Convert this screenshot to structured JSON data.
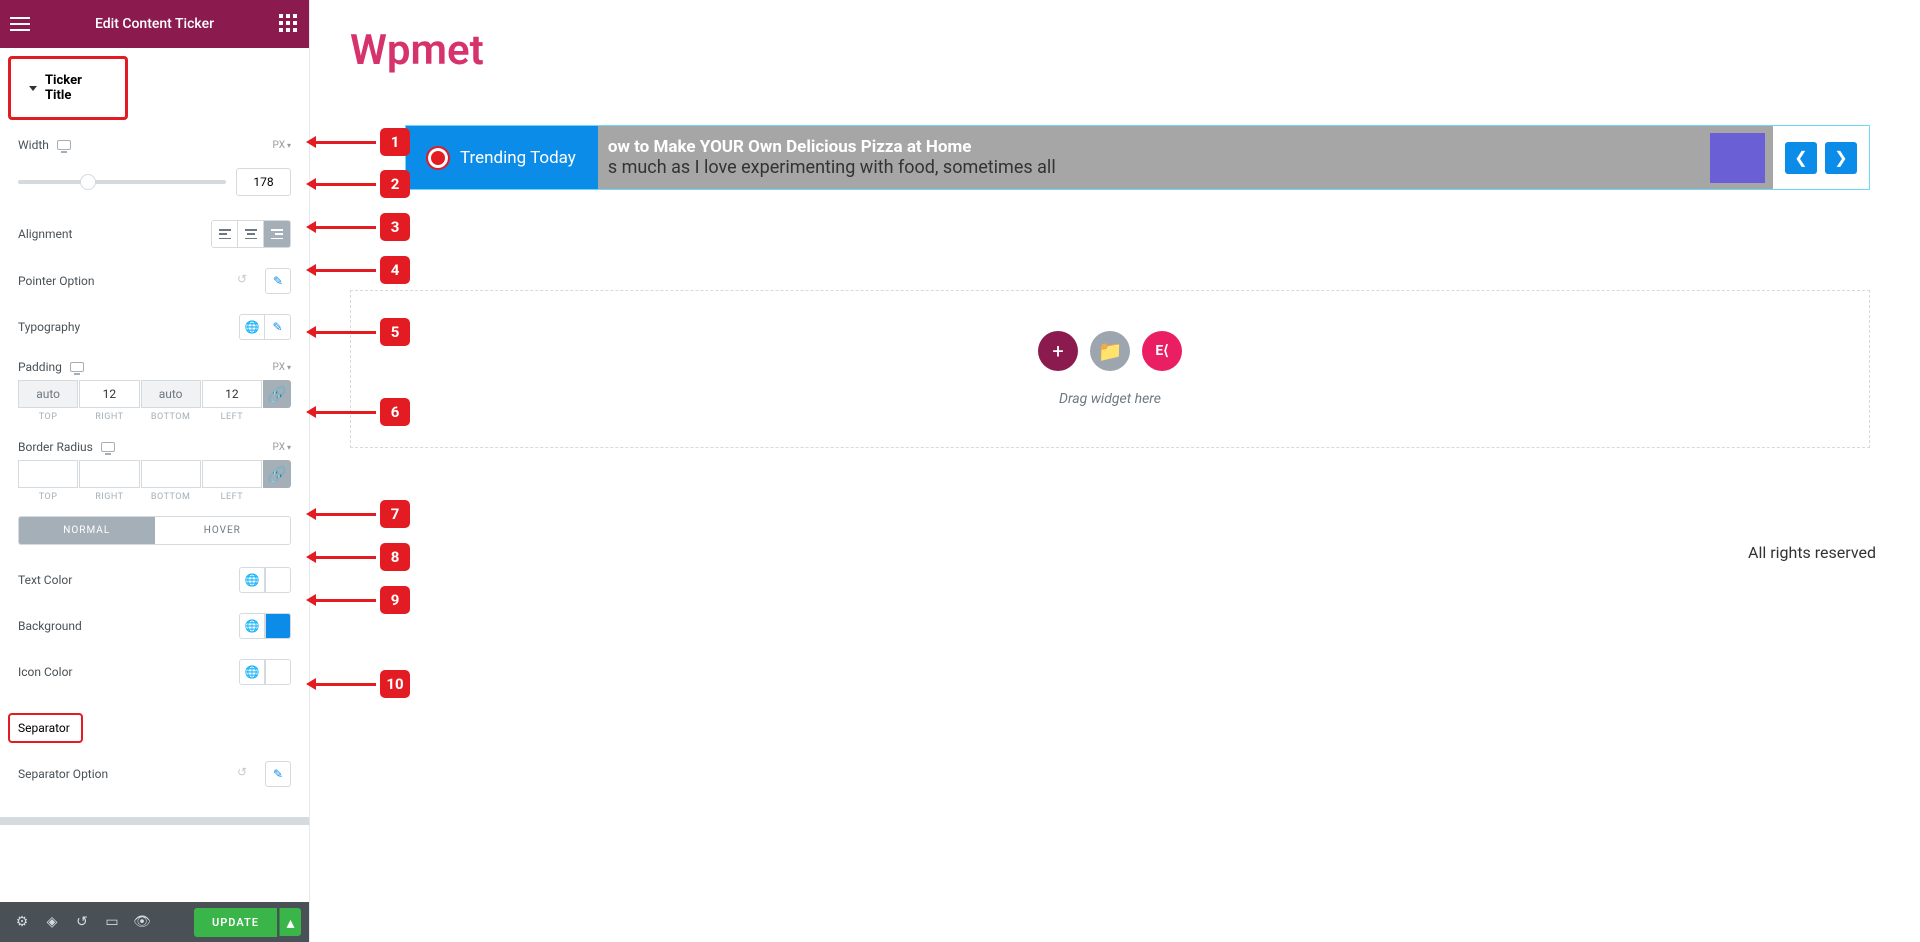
{
  "header": {
    "title": "Edit Content Ticker"
  },
  "sections": {
    "ticker_title": "Ticker Title",
    "separator": "Separator"
  },
  "controls": {
    "width": {
      "label": "Width",
      "unit": "PX",
      "value": "178"
    },
    "alignment": {
      "label": "Alignment"
    },
    "pointer": {
      "label": "Pointer Option"
    },
    "typography": {
      "label": "Typography"
    },
    "padding": {
      "label": "Padding",
      "unit": "PX",
      "top": "auto",
      "right": "12",
      "bottom": "auto",
      "left": "12",
      "labels": {
        "top": "TOP",
        "right": "RIGHT",
        "bottom": "BOTTOM",
        "left": "LEFT"
      }
    },
    "border_radius": {
      "label": "Border Radius",
      "unit": "PX",
      "labels": {
        "top": "TOP",
        "right": "RIGHT",
        "bottom": "BOTTOM",
        "left": "LEFT"
      }
    },
    "tabs": {
      "normal": "NORMAL",
      "hover": "HOVER"
    },
    "text_color": {
      "label": "Text Color"
    },
    "background": {
      "label": "Background",
      "color": "#0c8ce9"
    },
    "icon_color": {
      "label": "Icon Color"
    },
    "separator_option": {
      "label": "Separator Option"
    }
  },
  "footer": {
    "update": "UPDATE"
  },
  "preview": {
    "brand": "Wpmet",
    "ticker_title": "Trending Today",
    "headline": "ow to Make YOUR Own Delicious Pizza at Home",
    "subline": "s much as I love experimenting with food, sometimes all",
    "drop_text": "Drag widget here",
    "rights": "All rights reserved"
  },
  "callouts": [
    "1",
    "2",
    "3",
    "4",
    "5",
    "6",
    "7",
    "8",
    "9",
    "10"
  ]
}
